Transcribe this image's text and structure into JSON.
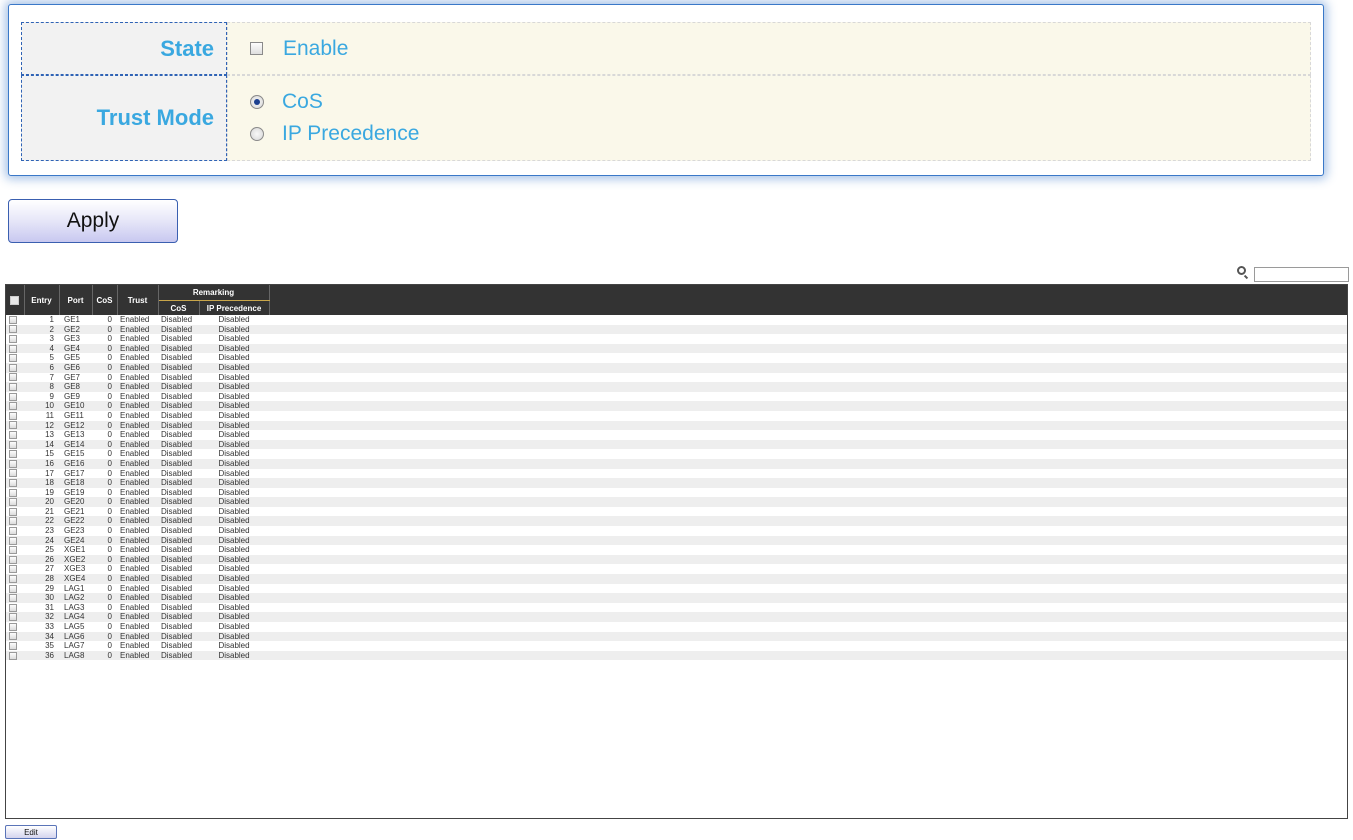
{
  "settings": {
    "state": {
      "label": "State",
      "option_label": "Enable",
      "checked": false
    },
    "trust_mode": {
      "label": "Trust Mode",
      "options": [
        {
          "label": "CoS",
          "selected": true
        },
        {
          "label": "IP Precedence",
          "selected": false
        }
      ]
    }
  },
  "apply_label": "Apply",
  "search": {
    "value": ""
  },
  "table": {
    "headers": {
      "entry": "Entry",
      "port": "Port",
      "cos": "CoS",
      "trust": "Trust",
      "remarking": "Remarking",
      "remark_cos": "CoS",
      "remark_ip": "IP Precedence"
    },
    "rows": [
      {
        "entry": "1",
        "port": "GE1",
        "cos": "0",
        "trust": "Enabled",
        "remark_cos": "Disabled",
        "remark_ip": "Disabled"
      },
      {
        "entry": "2",
        "port": "GE2",
        "cos": "0",
        "trust": "Enabled",
        "remark_cos": "Disabled",
        "remark_ip": "Disabled"
      },
      {
        "entry": "3",
        "port": "GE3",
        "cos": "0",
        "trust": "Enabled",
        "remark_cos": "Disabled",
        "remark_ip": "Disabled"
      },
      {
        "entry": "4",
        "port": "GE4",
        "cos": "0",
        "trust": "Enabled",
        "remark_cos": "Disabled",
        "remark_ip": "Disabled"
      },
      {
        "entry": "5",
        "port": "GE5",
        "cos": "0",
        "trust": "Enabled",
        "remark_cos": "Disabled",
        "remark_ip": "Disabled"
      },
      {
        "entry": "6",
        "port": "GE6",
        "cos": "0",
        "trust": "Enabled",
        "remark_cos": "Disabled",
        "remark_ip": "Disabled"
      },
      {
        "entry": "7",
        "port": "GE7",
        "cos": "0",
        "trust": "Enabled",
        "remark_cos": "Disabled",
        "remark_ip": "Disabled"
      },
      {
        "entry": "8",
        "port": "GE8",
        "cos": "0",
        "trust": "Enabled",
        "remark_cos": "Disabled",
        "remark_ip": "Disabled"
      },
      {
        "entry": "9",
        "port": "GE9",
        "cos": "0",
        "trust": "Enabled",
        "remark_cos": "Disabled",
        "remark_ip": "Disabled"
      },
      {
        "entry": "10",
        "port": "GE10",
        "cos": "0",
        "trust": "Enabled",
        "remark_cos": "Disabled",
        "remark_ip": "Disabled"
      },
      {
        "entry": "11",
        "port": "GE11",
        "cos": "0",
        "trust": "Enabled",
        "remark_cos": "Disabled",
        "remark_ip": "Disabled"
      },
      {
        "entry": "12",
        "port": "GE12",
        "cos": "0",
        "trust": "Enabled",
        "remark_cos": "Disabled",
        "remark_ip": "Disabled"
      },
      {
        "entry": "13",
        "port": "GE13",
        "cos": "0",
        "trust": "Enabled",
        "remark_cos": "Disabled",
        "remark_ip": "Disabled"
      },
      {
        "entry": "14",
        "port": "GE14",
        "cos": "0",
        "trust": "Enabled",
        "remark_cos": "Disabled",
        "remark_ip": "Disabled"
      },
      {
        "entry": "15",
        "port": "GE15",
        "cos": "0",
        "trust": "Enabled",
        "remark_cos": "Disabled",
        "remark_ip": "Disabled"
      },
      {
        "entry": "16",
        "port": "GE16",
        "cos": "0",
        "trust": "Enabled",
        "remark_cos": "Disabled",
        "remark_ip": "Disabled"
      },
      {
        "entry": "17",
        "port": "GE17",
        "cos": "0",
        "trust": "Enabled",
        "remark_cos": "Disabled",
        "remark_ip": "Disabled"
      },
      {
        "entry": "18",
        "port": "GE18",
        "cos": "0",
        "trust": "Enabled",
        "remark_cos": "Disabled",
        "remark_ip": "Disabled"
      },
      {
        "entry": "19",
        "port": "GE19",
        "cos": "0",
        "trust": "Enabled",
        "remark_cos": "Disabled",
        "remark_ip": "Disabled"
      },
      {
        "entry": "20",
        "port": "GE20",
        "cos": "0",
        "trust": "Enabled",
        "remark_cos": "Disabled",
        "remark_ip": "Disabled"
      },
      {
        "entry": "21",
        "port": "GE21",
        "cos": "0",
        "trust": "Enabled",
        "remark_cos": "Disabled",
        "remark_ip": "Disabled"
      },
      {
        "entry": "22",
        "port": "GE22",
        "cos": "0",
        "trust": "Enabled",
        "remark_cos": "Disabled",
        "remark_ip": "Disabled"
      },
      {
        "entry": "23",
        "port": "GE23",
        "cos": "0",
        "trust": "Enabled",
        "remark_cos": "Disabled",
        "remark_ip": "Disabled"
      },
      {
        "entry": "24",
        "port": "GE24",
        "cos": "0",
        "trust": "Enabled",
        "remark_cos": "Disabled",
        "remark_ip": "Disabled"
      },
      {
        "entry": "25",
        "port": "XGE1",
        "cos": "0",
        "trust": "Enabled",
        "remark_cos": "Disabled",
        "remark_ip": "Disabled"
      },
      {
        "entry": "26",
        "port": "XGE2",
        "cos": "0",
        "trust": "Enabled",
        "remark_cos": "Disabled",
        "remark_ip": "Disabled"
      },
      {
        "entry": "27",
        "port": "XGE3",
        "cos": "0",
        "trust": "Enabled",
        "remark_cos": "Disabled",
        "remark_ip": "Disabled"
      },
      {
        "entry": "28",
        "port": "XGE4",
        "cos": "0",
        "trust": "Enabled",
        "remark_cos": "Disabled",
        "remark_ip": "Disabled"
      },
      {
        "entry": "29",
        "port": "LAG1",
        "cos": "0",
        "trust": "Enabled",
        "remark_cos": "Disabled",
        "remark_ip": "Disabled"
      },
      {
        "entry": "30",
        "port": "LAG2",
        "cos": "0",
        "trust": "Enabled",
        "remark_cos": "Disabled",
        "remark_ip": "Disabled"
      },
      {
        "entry": "31",
        "port": "LAG3",
        "cos": "0",
        "trust": "Enabled",
        "remark_cos": "Disabled",
        "remark_ip": "Disabled"
      },
      {
        "entry": "32",
        "port": "LAG4",
        "cos": "0",
        "trust": "Enabled",
        "remark_cos": "Disabled",
        "remark_ip": "Disabled"
      },
      {
        "entry": "33",
        "port": "LAG5",
        "cos": "0",
        "trust": "Enabled",
        "remark_cos": "Disabled",
        "remark_ip": "Disabled"
      },
      {
        "entry": "34",
        "port": "LAG6",
        "cos": "0",
        "trust": "Enabled",
        "remark_cos": "Disabled",
        "remark_ip": "Disabled"
      },
      {
        "entry": "35",
        "port": "LAG7",
        "cos": "0",
        "trust": "Enabled",
        "remark_cos": "Disabled",
        "remark_ip": "Disabled"
      },
      {
        "entry": "36",
        "port": "LAG8",
        "cos": "0",
        "trust": "Enabled",
        "remark_cos": "Disabled",
        "remark_ip": "Disabled"
      }
    ]
  },
  "edit_label": "Edit",
  "colors": {
    "panel_border": "#3a78c8",
    "label_text": "#3aa8e0",
    "value_bg": "#faf8ea",
    "table_header_bg": "#333333"
  }
}
